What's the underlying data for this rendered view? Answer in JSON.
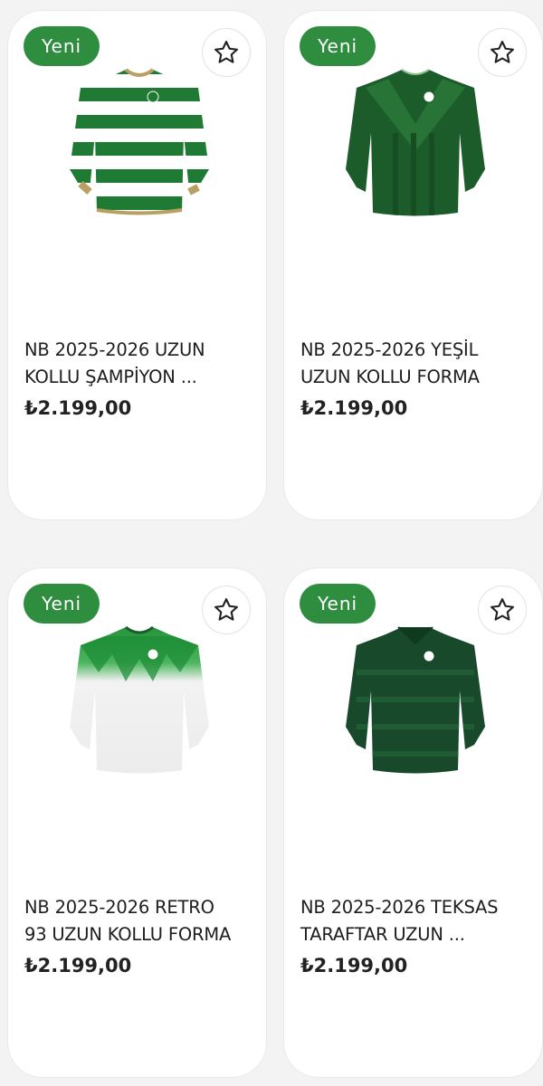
{
  "colors": {
    "badge_green": "#2e8d3f",
    "background": "#f3f3f3",
    "card": "#ffffff",
    "text": "#1e1e1e"
  },
  "products": [
    {
      "badge": "Yeni",
      "name_line1": "NB 2025-2026 UZUN",
      "name_line2": "KOLLU ŞAMPİYON ...",
      "price": "₺2.199,00",
      "favorite_icon": "star-outline-icon",
      "image": "green-white-hooped-long-sleeve-jersey"
    },
    {
      "badge": "Yeni",
      "name_line1": "NB 2025-2026 YEŞİL",
      "name_line2": "UZUN KOLLU FORMA",
      "price": "₺2.199,00",
      "favorite_icon": "star-outline-icon",
      "image": "dark-green-long-sleeve-jersey"
    },
    {
      "badge": "Yeni",
      "name_line1": "NB 2025-2026 RETRO",
      "name_line2": "93 UZUN KOLLU FORMA",
      "price": "₺2.199,00",
      "favorite_icon": "star-outline-icon",
      "image": "white-green-retro-long-sleeve-jersey"
    },
    {
      "badge": "Yeni",
      "name_line1": "NB 2025-2026 TEKSAS",
      "name_line2": "TARAFTAR UZUN ...",
      "price": "₺2.199,00",
      "favorite_icon": "star-outline-icon",
      "image": "dark-green-polo-long-sleeve-jersey"
    }
  ]
}
